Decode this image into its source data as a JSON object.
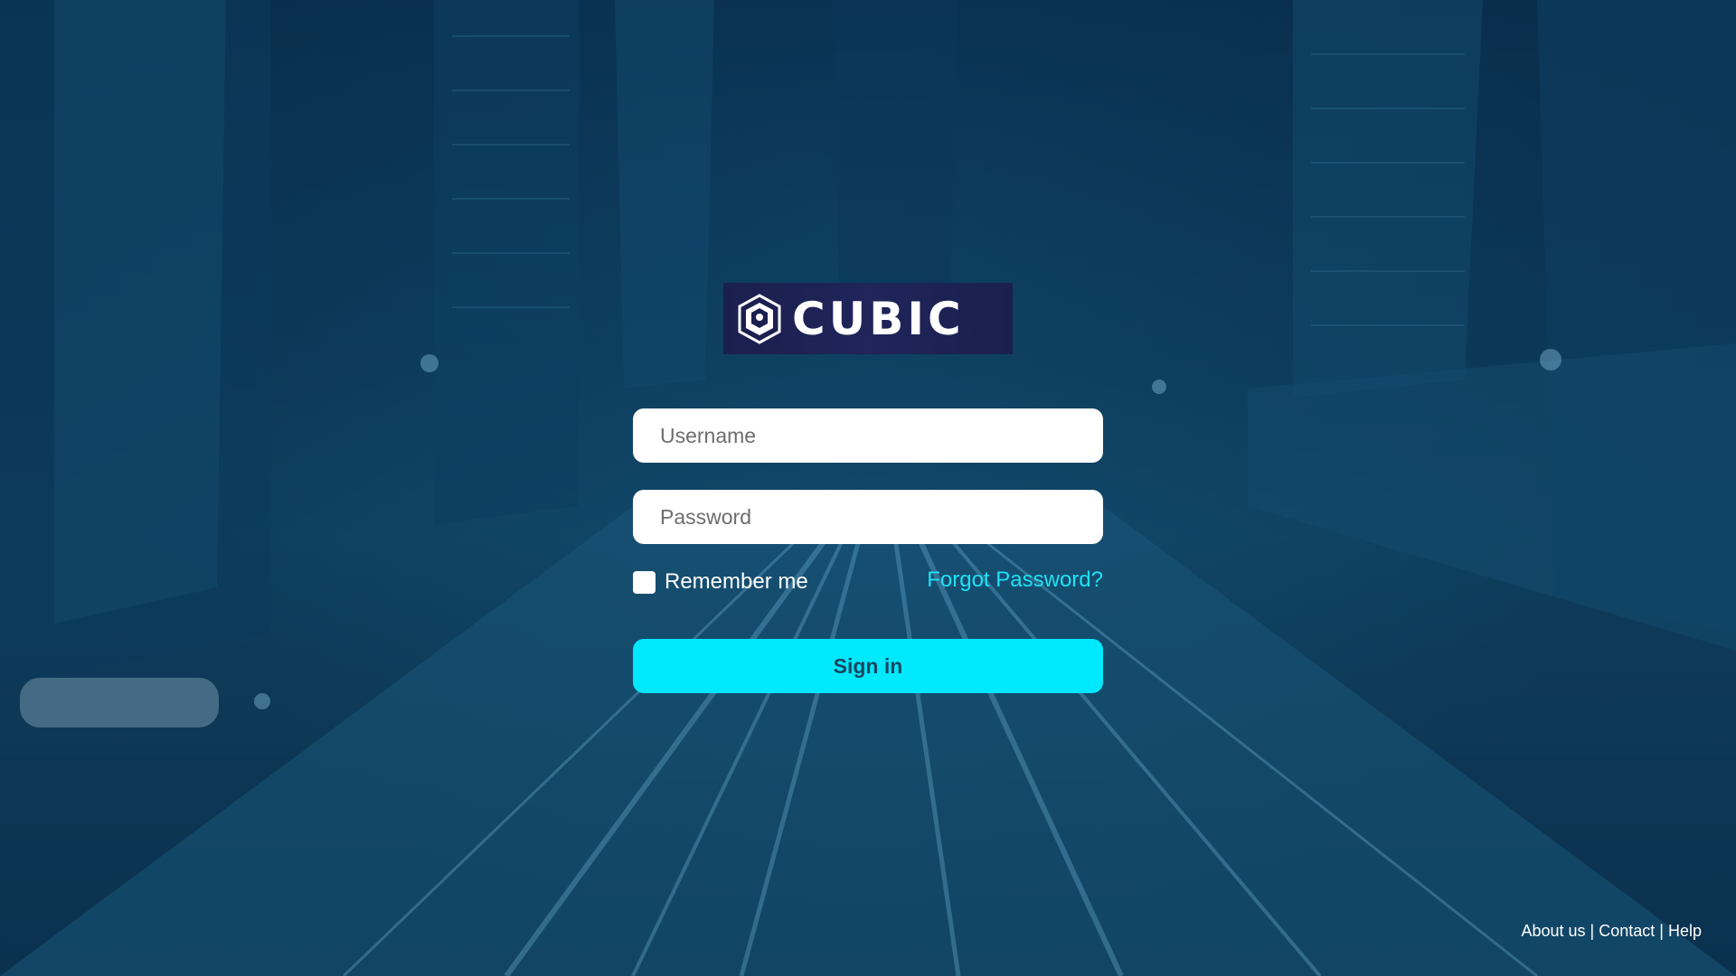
{
  "brand": {
    "name": "CUBIC"
  },
  "form": {
    "username_placeholder": "Username",
    "password_placeholder": "Password",
    "remember_label": "Remember me",
    "forgot_label": "Forgot Password?",
    "signin_label": "Sign in"
  },
  "footer": {
    "links": [
      "About us",
      "Contact",
      "Help"
    ],
    "separator": "|"
  },
  "colors": {
    "accent": "#00e8fc",
    "link": "#1ee2f5",
    "background": "#0f4467",
    "logo_bg": "#1a1f4e"
  }
}
